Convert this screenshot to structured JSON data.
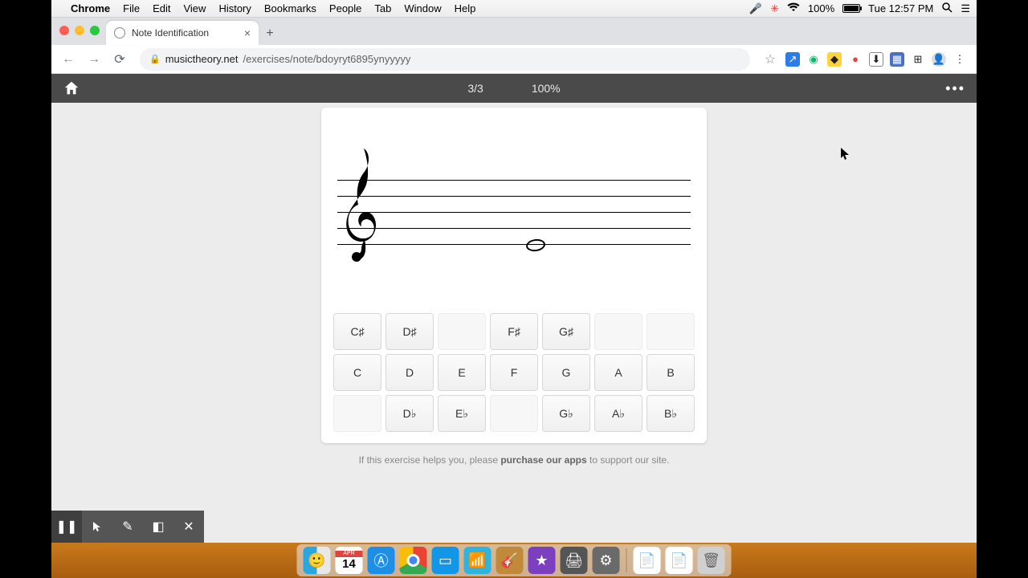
{
  "mac_menu": {
    "app": "Chrome",
    "items": [
      "File",
      "Edit",
      "View",
      "History",
      "Bookmarks",
      "People",
      "Tab",
      "Window",
      "Help"
    ],
    "battery_pct": "100%",
    "clock": "Tue 12:57 PM"
  },
  "browser": {
    "tab_title": "Note Identification",
    "url_domain": "musictheory.net",
    "url_path": "/exercises/note/bdoyryt6895ynyyyyy"
  },
  "app_header": {
    "progress": "3/3",
    "percent": "100%"
  },
  "note_grid": {
    "row_sharp": [
      "C♯",
      "D♯",
      "",
      "F♯",
      "G♯",
      "",
      ""
    ],
    "row_nat": [
      "C",
      "D",
      "E",
      "F",
      "G",
      "A",
      "B"
    ],
    "row_flat": [
      "",
      "D♭",
      "E♭",
      "",
      "G♭",
      "A♭",
      "B♭"
    ]
  },
  "support": {
    "pre": "If this exercise helps you, please ",
    "link": "purchase our apps",
    "post": " to support our site."
  },
  "dock": {
    "calendar_day": "14"
  }
}
